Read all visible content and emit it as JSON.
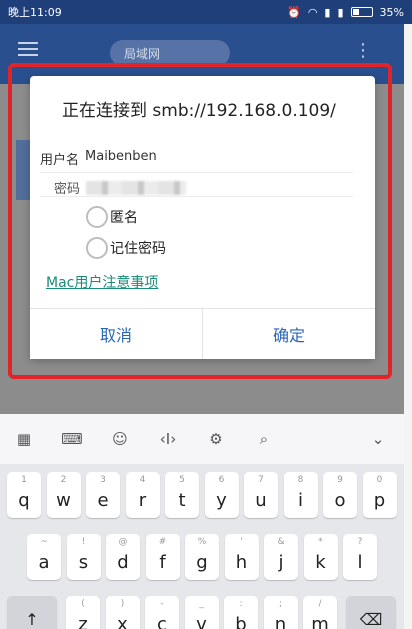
{
  "status": {
    "time": "晚上11:09",
    "battery": "35%"
  },
  "app": {
    "tab_label": "局域网",
    "more": "⋮"
  },
  "dialog": {
    "title": "正在连接到 smb://192.168.0.109/",
    "username_label": "用户名",
    "username_value": "Maibenben",
    "password_label": "密码",
    "anonymous_label": "匿名",
    "remember_label": "记住密码",
    "mac_link": "Mac用户注意事项",
    "cancel": "取消",
    "confirm": "确定"
  },
  "keyboard": {
    "toolbar": [
      "▦",
      "⌨",
      "☺",
      "‹I›",
      "⚙",
      "⌕",
      "⌄"
    ],
    "row1": [
      {
        "main": "q",
        "sub": "1"
      },
      {
        "main": "w",
        "sub": "2"
      },
      {
        "main": "e",
        "sub": "3"
      },
      {
        "main": "r",
        "sub": "4"
      },
      {
        "main": "t",
        "sub": "5"
      },
      {
        "main": "y",
        "sub": "6"
      },
      {
        "main": "u",
        "sub": "7"
      },
      {
        "main": "i",
        "sub": "8"
      },
      {
        "main": "o",
        "sub": "9"
      },
      {
        "main": "p",
        "sub": "0"
      }
    ],
    "row2": [
      {
        "main": "a",
        "sub": "~"
      },
      {
        "main": "s",
        "sub": "!"
      },
      {
        "main": "d",
        "sub": "@"
      },
      {
        "main": "f",
        "sub": "#"
      },
      {
        "main": "g",
        "sub": "%"
      },
      {
        "main": "h",
        "sub": "'"
      },
      {
        "main": "j",
        "sub": "&"
      },
      {
        "main": "k",
        "sub": "*"
      },
      {
        "main": "l",
        "sub": "?"
      }
    ],
    "row3": [
      {
        "main": "z",
        "sub": "("
      },
      {
        "main": "x",
        "sub": ")"
      },
      {
        "main": "c",
        "sub": "-"
      },
      {
        "main": "v",
        "sub": "_"
      },
      {
        "main": "b",
        "sub": ":"
      },
      {
        "main": "n",
        "sub": ";"
      },
      {
        "main": "m",
        "sub": "/"
      }
    ],
    "shift": "↑",
    "backspace": "⌫"
  }
}
